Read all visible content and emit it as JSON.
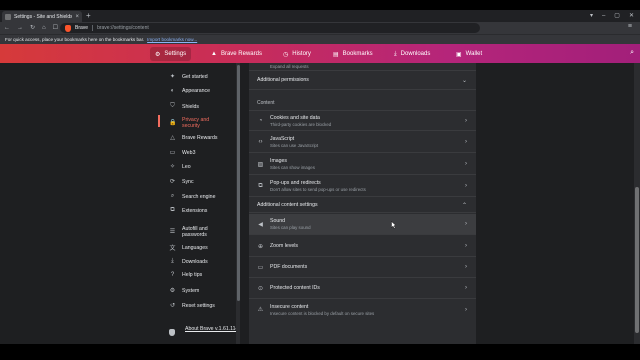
{
  "browser": {
    "tab_title": "Settings - Site and Shields S",
    "tab_close": "×",
    "new_tab": "+",
    "window_controls": [
      "▾",
      "–",
      "▢",
      "✕"
    ],
    "nav_buttons": [
      "←",
      "→",
      "↻",
      "⌂",
      "☐"
    ],
    "omnibox_label": "Brave",
    "url": "brave://settings/content",
    "menu_glyph": "≡",
    "bookmarks_prompt": "For quick access, place your bookmarks here on the bookmarks bar.",
    "bookmarks_import_link": "Import bookmarks now..."
  },
  "header": {
    "tabs": [
      {
        "label": "Settings",
        "icon": "gear-icon",
        "glyph": "⚙"
      },
      {
        "label": "Brave Rewards",
        "icon": "triangle-icon",
        "glyph": "▲"
      },
      {
        "label": "History",
        "icon": "clock-icon",
        "glyph": "◷"
      },
      {
        "label": "Bookmarks",
        "icon": "bookmarks-icon",
        "glyph": "▤"
      },
      {
        "label": "Downloads",
        "icon": "download-icon",
        "glyph": "⤓"
      },
      {
        "label": "Wallet",
        "icon": "wallet-icon",
        "glyph": "▣"
      }
    ],
    "search_glyph": "⌕",
    "accent_colors": [
      "#d63a3a",
      "#c92d57",
      "#a21f7a"
    ]
  },
  "sidebar": {
    "items": [
      {
        "label": "Get started",
        "icon": "rocket-icon",
        "glyph": "✦"
      },
      {
        "label": "Appearance",
        "icon": "palette-icon",
        "glyph": "◐"
      },
      {
        "label": "Shields",
        "icon": "shield-icon",
        "glyph": "⛉"
      },
      {
        "label": "Privacy and security",
        "icon": "lock-icon",
        "glyph": "🔒",
        "active": true
      },
      {
        "label": "Brave Rewards",
        "icon": "triangle-icon",
        "glyph": "△"
      },
      {
        "label": "Web3",
        "icon": "wallet-icon",
        "glyph": "▭"
      },
      {
        "label": "Leo",
        "icon": "star-icon",
        "glyph": "✧"
      },
      {
        "label": "Sync",
        "icon": "sync-icon",
        "glyph": "⟳"
      },
      {
        "label": "Search engine",
        "icon": "search-icon",
        "glyph": "⌕"
      },
      {
        "label": "Extensions",
        "icon": "puzzle-icon",
        "glyph": "⧉"
      },
      {
        "label": "Autofill and passwords",
        "icon": "list-icon",
        "glyph": "☰"
      },
      {
        "label": "Languages",
        "icon": "language-icon",
        "glyph": "文"
      },
      {
        "label": "Downloads",
        "icon": "download-icon",
        "glyph": "⤓"
      },
      {
        "label": "Help tips",
        "icon": "help-icon",
        "glyph": "?"
      },
      {
        "label": "System",
        "icon": "system-icon",
        "glyph": "⚙"
      },
      {
        "label": "Reset settings",
        "icon": "reset-icon",
        "glyph": "↺"
      }
    ],
    "active_color": "#f36d5f",
    "about": "About Brave v.1.61.114"
  },
  "content": {
    "top_partial_sub": "Expand all requests",
    "additional_permissions": "Additional permissions",
    "content_section_label": "Content",
    "rows": [
      {
        "title": "Cookies and site data",
        "sub": "Third-party cookies are blocked",
        "icon": "cookie-icon",
        "glyph": "◔"
      },
      {
        "title": "JavaScript",
        "sub": "Sites can use JavaScript",
        "icon": "code-icon",
        "glyph": "‹›"
      },
      {
        "title": "Images",
        "sub": "Sites can show images",
        "icon": "image-icon",
        "glyph": "▨"
      },
      {
        "title": "Pop-ups and redirects",
        "sub": "Don't allow sites to send pop-ups or use redirects",
        "icon": "popup-icon",
        "glyph": "⧉"
      }
    ],
    "additional_content_settings": "Additional content settings",
    "additional_rows": [
      {
        "title": "Sound",
        "sub": "Sites can play sound",
        "icon": "sound-icon",
        "glyph": "◀"
      },
      {
        "title": "Zoom levels",
        "sub": "",
        "icon": "zoom-icon",
        "glyph": "⊕"
      },
      {
        "title": "PDF documents",
        "sub": "",
        "icon": "pdf-icon",
        "glyph": "▭"
      },
      {
        "title": "Protected content IDs",
        "sub": "",
        "icon": "protected-icon",
        "glyph": "⊙"
      },
      {
        "title": "Insecure content",
        "sub": "Insecure content is blocked by default on secure sites",
        "icon": "warning-icon",
        "glyph": "⚠"
      }
    ],
    "arrow_glyph": "›",
    "expand_glyph": "⌄",
    "collapse_glyph": "⌃"
  }
}
